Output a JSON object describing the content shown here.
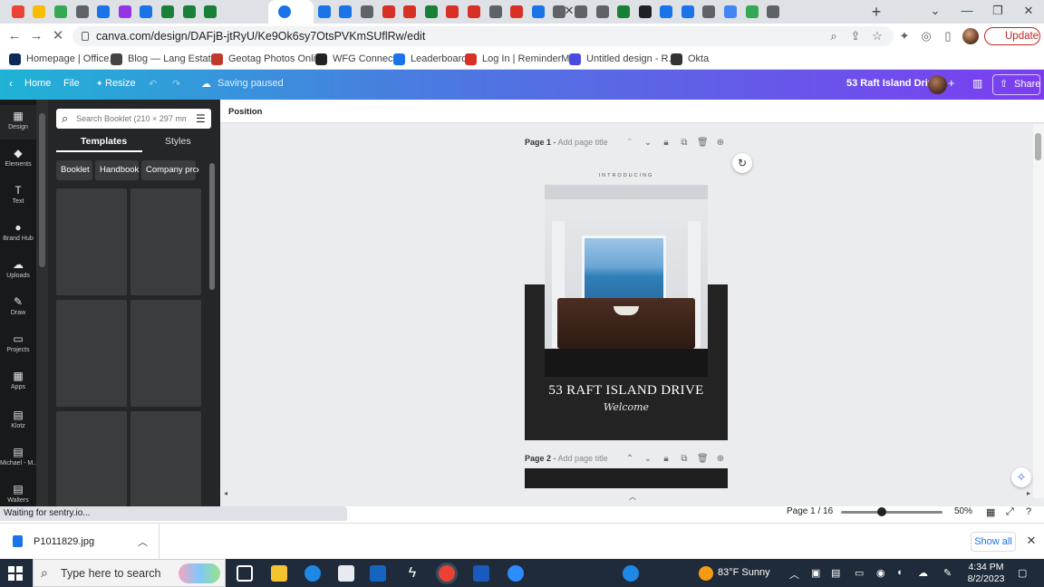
{
  "browser": {
    "url": "canva.com/design/DAFjB-jtRyU/Ke9Ok6sy7OtsPVKmSUflRw/edit",
    "update_label": "Update",
    "tab_colors": [
      "#ea4335",
      "#fbbc04",
      "#34a853",
      "#5f6368",
      "#1a73e8",
      "#9334e6",
      "#1a73e8",
      "#188038",
      "#188038",
      "#188038"
    ],
    "tab_colors_right": [
      "#1a73e8",
      "#1a73e8",
      "#5f6368",
      "#d93025",
      "#d93025",
      "#188038",
      "#d93025",
      "#d93025",
      "#5f6368",
      "#d93025",
      "#1a73e8",
      "#5f6368",
      "#5f6368",
      "#5f6368",
      "#188038",
      "#202124",
      "#1a73e8",
      "#1a73e8",
      "#5f6368",
      "#4285f4",
      "#34a853",
      "#5f6368"
    ]
  },
  "bookmarks": [
    {
      "label": "Homepage | Office...",
      "color": "#0b2a5b"
    },
    {
      "label": "Blog — Lang Estates",
      "color": "#444444"
    },
    {
      "label": "Geotag Photos Onli...",
      "color": "#c0392b"
    },
    {
      "label": "WFG Connect",
      "color": "#222222"
    },
    {
      "label": "Leaderboard",
      "color": "#1a73e8"
    },
    {
      "label": "Log In | ReminderM...",
      "color": "#d93025"
    },
    {
      "label": "Untitled design - R...",
      "color": "#4a4ae0"
    },
    {
      "label": "Okta",
      "color": "#333333"
    }
  ],
  "canva": {
    "home_label": "Home",
    "file_label": "File",
    "resize_label": "Resize",
    "saving_status": "Saving paused",
    "design_title": "53 Raft Island Drive",
    "share_label": "Share"
  },
  "rail": [
    {
      "label": "Design",
      "icon": "▦"
    },
    {
      "label": "Elements",
      "icon": "◆"
    },
    {
      "label": "Text",
      "icon": "T"
    },
    {
      "label": "Brand Hub",
      "icon": "●"
    },
    {
      "label": "Uploads",
      "icon": "☁"
    },
    {
      "label": "Draw",
      "icon": "✎"
    },
    {
      "label": "Projects",
      "icon": "▭"
    },
    {
      "label": "Apps",
      "icon": "▦"
    },
    {
      "label": "Klotz",
      "icon": "▤"
    },
    {
      "label": "Michael - M...",
      "icon": "▤"
    },
    {
      "label": "Walters",
      "icon": "▤"
    }
  ],
  "panel": {
    "search_placeholder": "Search Booklet (210 × 297 mm) te",
    "tab_templates": "Templates",
    "tab_styles": "Styles",
    "chips": [
      "Booklet",
      "Handbook",
      "Company profi"
    ]
  },
  "canvas": {
    "position_label": "Position",
    "page1_label": "Page 1",
    "page2_label": "Page 2",
    "add_title": "Add page title",
    "introducing": "INTRODUCING",
    "title": "53 RAFT ISLAND DRIVE",
    "welcome": "Welcome"
  },
  "footer": {
    "status": "Waiting for sentry.io...",
    "page_indicator": "Page 1 / 16",
    "zoom": "50%"
  },
  "download": {
    "filename": "P1011829.jpg",
    "show_all": "Show all"
  },
  "taskbar": {
    "search_placeholder": "Type here to search",
    "weather": "83°F  Sunny",
    "time": "4:34 PM",
    "date": "8/2/2023"
  }
}
